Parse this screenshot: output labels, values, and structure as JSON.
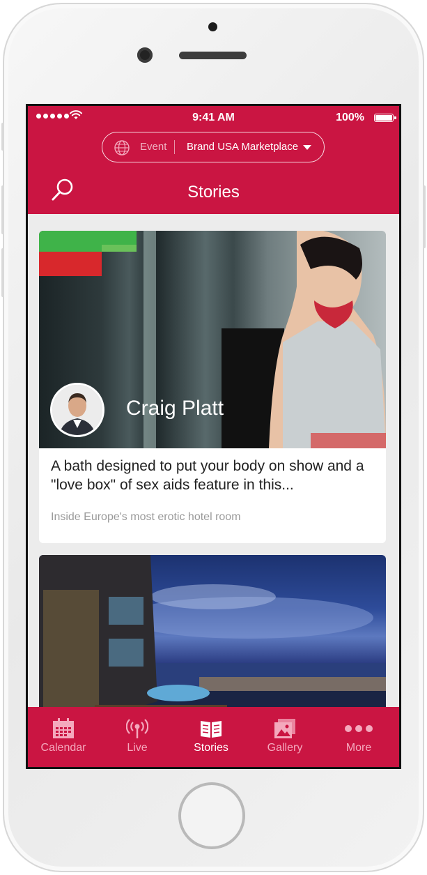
{
  "status_bar": {
    "time": "9:41 AM",
    "battery": "100%"
  },
  "event_selector": {
    "label": "Event",
    "value": "Brand USA Marketplace"
  },
  "header": {
    "title": "Stories"
  },
  "stories": [
    {
      "author": "Craig Platt",
      "title": "A bath designed to put your body on show and a \"love box\" of sex aids feature in this...",
      "subtitle": "Inside Europe's most erotic hotel room"
    }
  ],
  "tabs": [
    {
      "label": "Calendar",
      "icon": "calendar-icon",
      "active": false
    },
    {
      "label": "Live",
      "icon": "broadcast-icon",
      "active": false
    },
    {
      "label": "Stories",
      "icon": "book-icon",
      "active": true
    },
    {
      "label": "Gallery",
      "icon": "gallery-icon",
      "active": false
    },
    {
      "label": "More",
      "icon": "more-dots-icon",
      "active": false
    }
  ],
  "colors": {
    "brand": "#ca1542",
    "tab_inactive": "#f4a9bd",
    "background": "#ececec"
  }
}
